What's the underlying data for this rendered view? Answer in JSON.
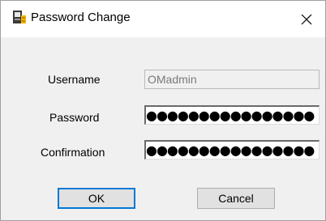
{
  "window": {
    "title": "Password Change",
    "close_icon": "close-icon",
    "app_icon": "app-icon"
  },
  "form": {
    "username_label": "Username",
    "username_value": "OMadmin",
    "password_label": "Password",
    "password_mask": "●●●●●●●●●●●●●●●●",
    "confirmation_label": "Confirmation",
    "confirmation_mask": "●●●●●●●●●●●●●●●●"
  },
  "buttons": {
    "ok_label": "OK",
    "cancel_label": "Cancel"
  },
  "colors": {
    "accent": "#0078d7",
    "dialog_bg": "#f0f0f0",
    "button_bg": "#e1e1e1"
  }
}
